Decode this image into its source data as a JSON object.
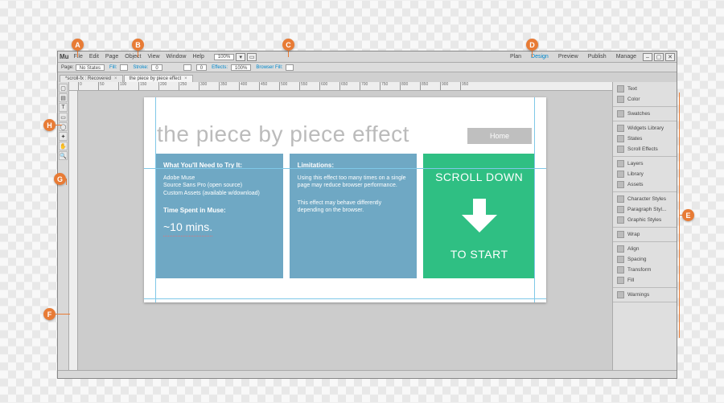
{
  "app_title": "Mu",
  "menu": {
    "items": [
      "File",
      "Edit",
      "Page",
      "Object",
      "View",
      "Window",
      "Help"
    ],
    "zoom": "100%"
  },
  "modes": {
    "items": [
      "Plan",
      "Design",
      "Preview",
      "Publish",
      "Manage"
    ],
    "active": "Design"
  },
  "control": {
    "page_lbl": "Page:",
    "page_val": "No States",
    "fill": "Fill:",
    "stroke": "Stroke:",
    "stroke_val": "0",
    "rot": "0",
    "effects": "Effects:",
    "opacity": "100%",
    "browserfill": "Browser Fill:"
  },
  "tabs": [
    {
      "label": "*scroll-fx : Recovered"
    },
    {
      "label": "the piece by piece effect",
      "active": true
    }
  ],
  "ruler_ticks": [
    "0",
    "50",
    "100",
    "150",
    "200",
    "250",
    "300",
    "350",
    "400",
    "450",
    "500",
    "550",
    "600",
    "650",
    "700",
    "750",
    "800",
    "850",
    "900",
    "950"
  ],
  "tools": [
    "▢",
    "▤",
    "T",
    "▭",
    "◯",
    "✦",
    "✋",
    "🔍"
  ],
  "headline": "the piece by piece effect",
  "home": "Home",
  "card1": {
    "h1": "What You'll Need to Try It:",
    "l1": "Adobe Muse",
    "l2": "Source Sans Pro (open source)",
    "l3": "Custom Assets (available w/download)",
    "h2": "Time Spent in Muse:",
    "big": "~10 mins."
  },
  "card2": {
    "h1": "Limitations:",
    "l1": "Using this effect too many times on a single page may reduce browser performance.",
    "l2": "This effect may behave differently depending on the browser."
  },
  "card3": {
    "t1": "SCROLL DOWN",
    "t2": "TO START"
  },
  "panels": [
    [
      {
        "n": "Text"
      },
      {
        "n": "Color"
      }
    ],
    [
      {
        "n": "Swatches"
      }
    ],
    [
      {
        "n": "Widgets Library"
      },
      {
        "n": "States"
      },
      {
        "n": "Scroll Effects"
      }
    ],
    [
      {
        "n": "Layers"
      },
      {
        "n": "Library"
      },
      {
        "n": "Assets"
      }
    ],
    [
      {
        "n": "Character Styles"
      },
      {
        "n": "Paragraph Styl..."
      },
      {
        "n": "Graphic Styles"
      }
    ],
    [
      {
        "n": "Wrap"
      }
    ],
    [
      {
        "n": "Align"
      },
      {
        "n": "Spacing"
      },
      {
        "n": "Transform"
      },
      {
        "n": "Fill"
      }
    ],
    [
      {
        "n": "Warnings"
      }
    ]
  ],
  "callouts": {
    "A": "A",
    "B": "B",
    "C": "C",
    "D": "D",
    "E": "E",
    "F": "F",
    "G": "G",
    "H": "H"
  }
}
